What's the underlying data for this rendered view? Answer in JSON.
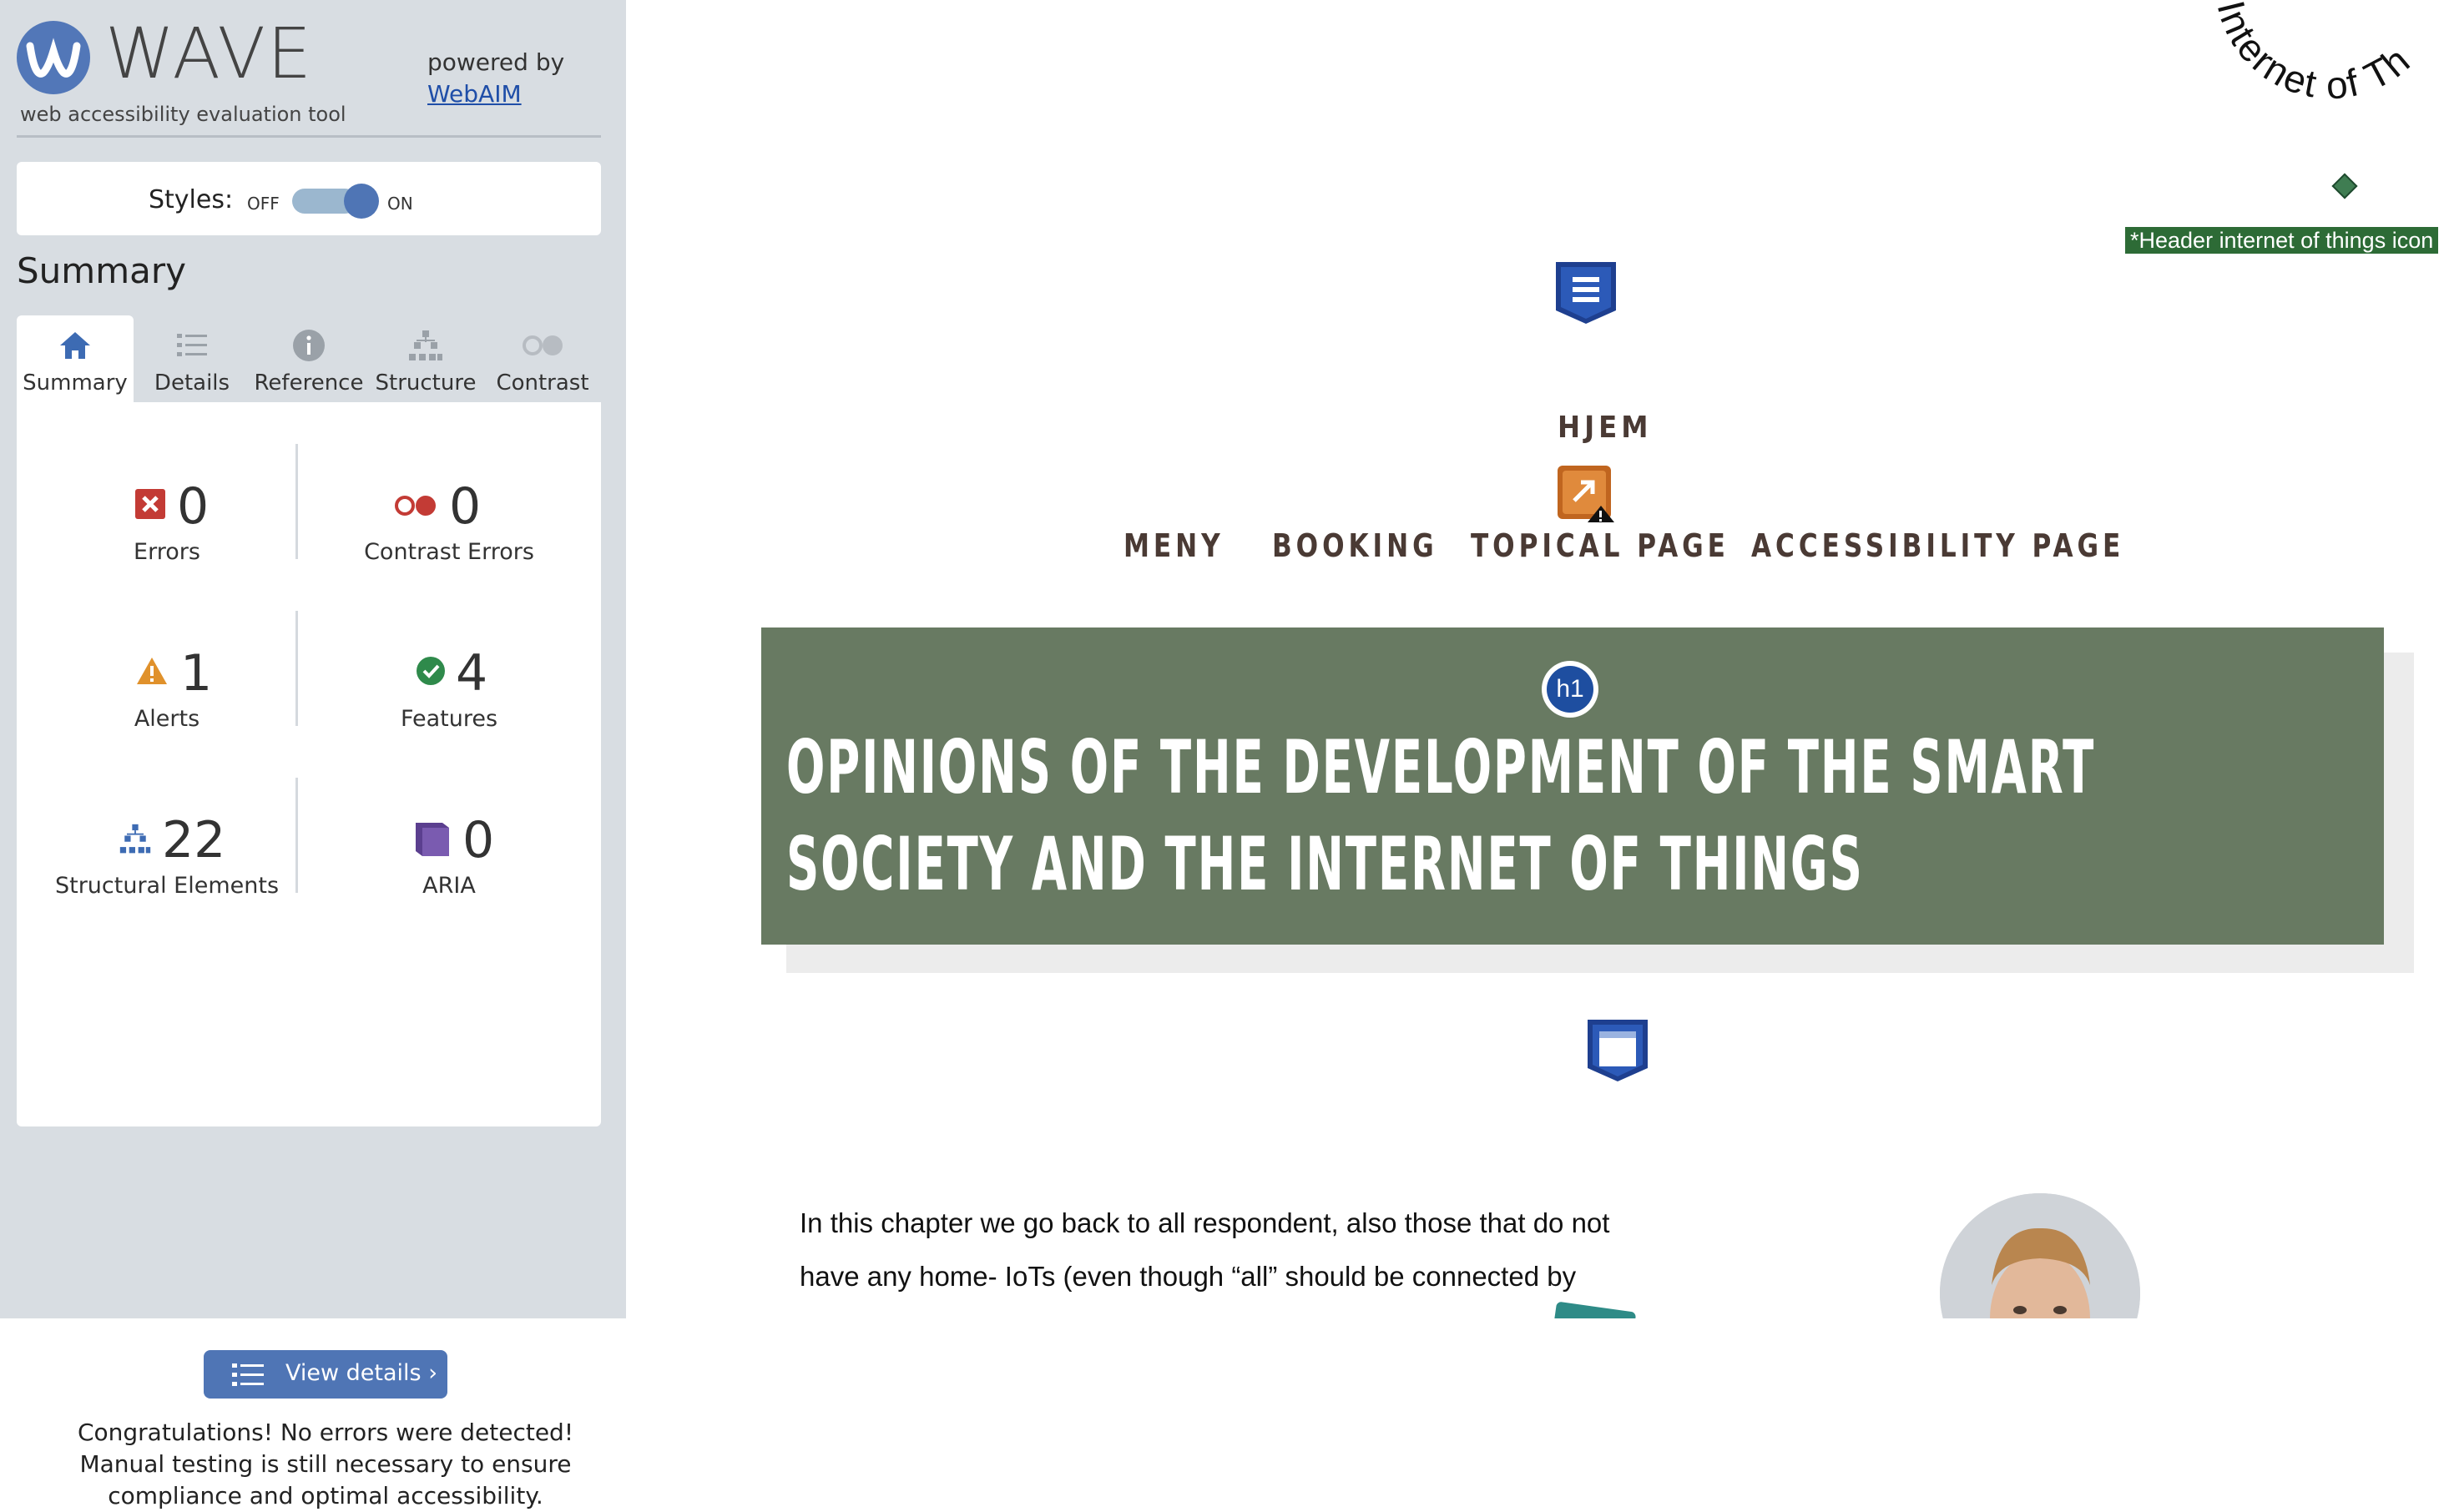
{
  "sidebar": {
    "logo": {
      "name": "WAVE",
      "subtitle": "web accessibility evaluation tool"
    },
    "powered_by": {
      "label": "powered by",
      "link": "WebAIM"
    },
    "styles": {
      "label": "Styles:",
      "off": "OFF",
      "on": "ON",
      "state": "on"
    },
    "summary_heading": "Summary",
    "tabs": [
      {
        "label": "Summary",
        "icon": "home-icon",
        "active": true
      },
      {
        "label": "Details",
        "icon": "list-icon",
        "active": false
      },
      {
        "label": "Reference",
        "icon": "info-icon",
        "active": false
      },
      {
        "label": "Structure",
        "icon": "structure-icon",
        "active": false
      },
      {
        "label": "Contrast",
        "icon": "contrast-icon",
        "active": false
      }
    ],
    "stats": {
      "errors": {
        "value": "0",
        "label": "Errors",
        "color": "#c0392b"
      },
      "contrast_errors": {
        "value": "0",
        "label": "Contrast Errors",
        "color": "#c0392b"
      },
      "alerts": {
        "value": "1",
        "label": "Alerts",
        "color": "#e0912b"
      },
      "features": {
        "value": "4",
        "label": "Features",
        "color": "#2f8a4b"
      },
      "structural": {
        "value": "22",
        "label": "Structural Elements",
        "color": "#3d6bb3"
      },
      "aria": {
        "value": "0",
        "label": "ARIA",
        "color": "#5b3f8f"
      }
    },
    "view_details": "View details ›",
    "congrats": "Congratulations! No errors were detected! Manual testing is still necessary to ensure compliance and optimal accessibility."
  },
  "page": {
    "circular_logo_text": "Internet of Th",
    "alt_tag": "*Header internet of things icon",
    "home_link": "HJEM",
    "nav": [
      "MENY",
      "BOOKING",
      "TOPICAL PAGE",
      "ACCESSIBILITY PAGE"
    ],
    "h1_badge": "h1",
    "hero_title_line1": "OPINIONS OF THE DEVELOPMENT OF THE SMART",
    "hero_title_line2": "SOCIETY AND THE INTERNET OF THINGS",
    "hero_color": "#687a62",
    "paragraph_line1": "In this chapter we go back to all respondent, also those that do not",
    "paragraph_line2": "have any home- IoTs (even though “all” should be connected by"
  }
}
